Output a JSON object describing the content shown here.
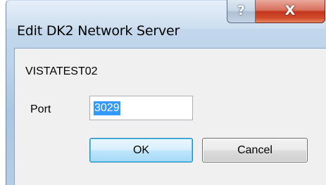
{
  "window": {
    "title": "Edit DK2 Network Server",
    "help_glyph": "?",
    "close_glyph": "X"
  },
  "content": {
    "server_name": "VISTATEST02",
    "port_label": "Port",
    "port_value": "3029"
  },
  "buttons": {
    "ok_label": "OK",
    "cancel_label": "Cancel"
  },
  "colors": {
    "selection": "#3399ff",
    "close_button": "#c2361d",
    "dialog_background": "#f0f0f0"
  }
}
